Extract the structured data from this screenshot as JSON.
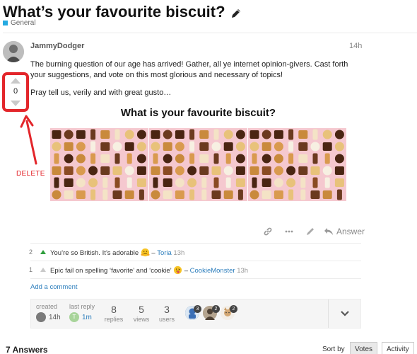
{
  "topic": {
    "title": "What’s your favourite biscuit?",
    "category": "General",
    "category_color": "#25aae1"
  },
  "post": {
    "author": "JammyDodger",
    "age": "14h",
    "paragraph1": "The burning question of our age has arrived! Gather, all ye internet opinion-givers. Cast forth your suggestions, and vote on this most glorious and necessary of topics!",
    "paragraph2": "Pray tell us, verily and with great gusto…",
    "image_title": "What is your favourite biscuit?",
    "vote_count": "0",
    "actions": {
      "icons": [
        "link-icon",
        "more-icon",
        "pencil-icon"
      ],
      "answer_label": "Answer"
    }
  },
  "annotation": {
    "label": "DELETE",
    "color": "#e3262b"
  },
  "comments": [
    {
      "votes": "2",
      "text": "You’re so British. It’s adorable",
      "emoji": "hugging-face-icon",
      "author": "Toria",
      "time": "13h",
      "arrow_color": "#2e9e3c"
    },
    {
      "votes": "1",
      "text": "Epic fail on spelling ‘favorite’ and ‘cookie’",
      "emoji": "tongue-face-icon",
      "author": "CookieMonster",
      "time": "13h",
      "arrow_color": "#c9c9c9"
    }
  ],
  "add_comment": "Add a comment",
  "topic_map": {
    "created_label": "created",
    "created_value": "14h",
    "last_reply_label": "last reply",
    "last_reply_value": "1m",
    "last_reply_avatar_letter": "T",
    "replies": {
      "num": "8",
      "label": "replies"
    },
    "views": {
      "num": "5",
      "label": "views"
    },
    "users": {
      "num": "3",
      "label": "users"
    },
    "participant_badges": [
      "3",
      "2",
      "2"
    ]
  },
  "answers": {
    "count_label": "7 Answers",
    "sort_by": "Sort by",
    "sort_options": [
      "Votes",
      "Activity"
    ],
    "active_sort": "Votes"
  },
  "link_color": "#2e7fbd"
}
